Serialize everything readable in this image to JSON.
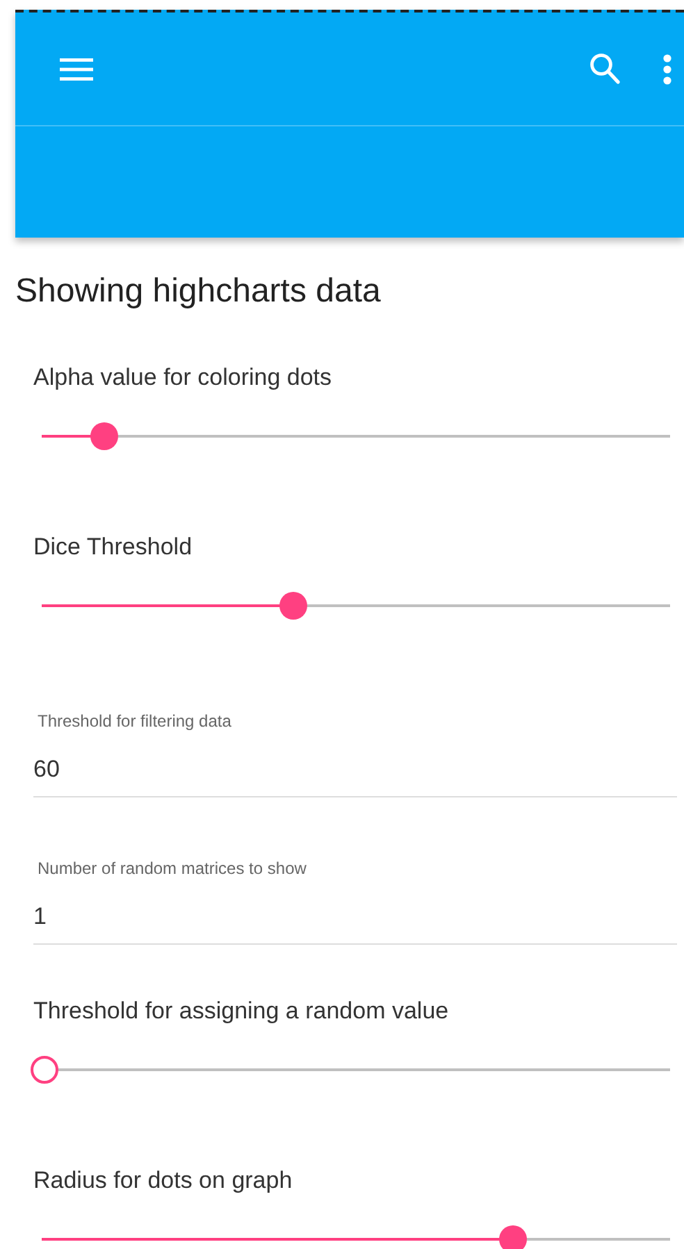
{
  "heading": "Showing highcharts data",
  "controls": [
    {
      "kind": "slider",
      "label": "Alpha value for coloring dots",
      "level": 0.1
    },
    {
      "kind": "slider",
      "label": "Dice Threshold",
      "level": 0.4
    },
    {
      "kind": "text",
      "label": "Threshold for filtering data",
      "value": "60"
    },
    {
      "kind": "text",
      "label": "Number of random matrices to show",
      "value": "1"
    },
    {
      "kind": "slider",
      "label": "Threshold for assigning a random value",
      "level": 0
    },
    {
      "kind": "slider",
      "label": "Radius for dots on graph",
      "level": 0.75
    }
  ]
}
